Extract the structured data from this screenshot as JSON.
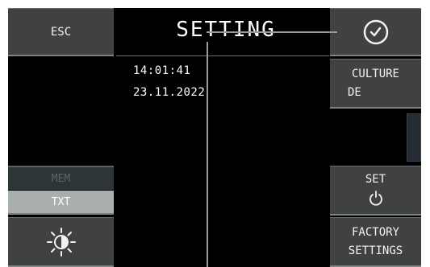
{
  "header": {
    "title": "SETTING"
  },
  "left_panel": {
    "esc_label": "ESC",
    "mem_label": "MEM",
    "txt_label": "TXT",
    "brightness_icon": "brightness-icon"
  },
  "datetime": {
    "time": "14:01:41",
    "date": "23.11.2022"
  },
  "right_panel": {
    "clock_icon": "clock-icon",
    "culture_label": "CULTURE",
    "culture_value": "DE",
    "set_label": "SET",
    "set_icon": "power-icon",
    "factory_line1": "FACTORY",
    "factory_line2": "SETTINGS"
  },
  "colors": {
    "accent_line": "#c9472a",
    "button_bg": "#404142",
    "screen_bg": "#000000",
    "txt_active_bg": "#a9b0ac"
  }
}
